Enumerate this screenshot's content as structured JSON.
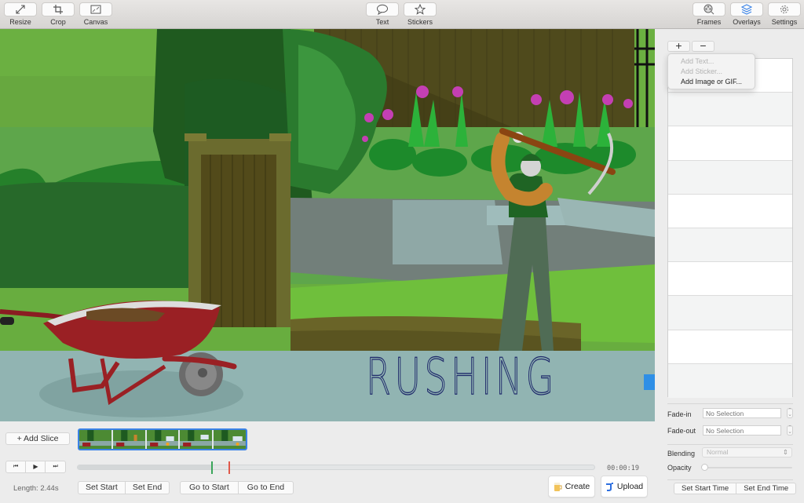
{
  "toolbar": {
    "left": [
      {
        "label": "Resize",
        "icon": "resize-icon"
      },
      {
        "label": "Crop",
        "icon": "crop-icon"
      },
      {
        "label": "Canvas",
        "icon": "canvas-icon"
      }
    ],
    "center": [
      {
        "label": "Text",
        "icon": "speech-bubble-icon"
      },
      {
        "label": "Stickers",
        "icon": "star-icon"
      }
    ],
    "right": [
      {
        "label": "Frames",
        "icon": "film-reel-icon"
      },
      {
        "label": "Overlays",
        "icon": "layers-icon",
        "active": true
      },
      {
        "label": "Settings",
        "icon": "gear-icon"
      }
    ]
  },
  "canvas": {
    "caption_text": "RUSHING",
    "caption_color": "#1f2a6b"
  },
  "sidebar": {
    "add_label": "+",
    "remove_label": "−",
    "add_menu": [
      {
        "label": "Add Text...",
        "enabled": false
      },
      {
        "label": "Add Sticker...",
        "enabled": false
      },
      {
        "label": "Add Image or GIF...",
        "enabled": true
      }
    ],
    "overlay_rows": 10,
    "fade_in": {
      "label": "Fade-in",
      "placeholder": "No Selection"
    },
    "fade_out": {
      "label": "Fade-out",
      "placeholder": "No Selection"
    },
    "blending": {
      "label": "Blending",
      "value": "Normal"
    },
    "opacity": {
      "label": "Opacity",
      "value": 0
    },
    "set_start_time": "Set Start Time",
    "set_end_time": "Set End Time"
  },
  "bottom": {
    "add_slice": "+ Add Slice",
    "filmstrip_frames": 5,
    "playback": {
      "prev": "⏮",
      "play": "▶",
      "next": "⏭"
    },
    "timeline": {
      "progress": 0.26,
      "start_marker": 0.258,
      "end_marker": 0.292
    },
    "timecode": "00:00:19",
    "length": "Length: 2.44s",
    "set_start": "Set Start",
    "set_end": "Set End",
    "go_to_start": "Go to Start",
    "go_to_end": "Go to End",
    "create": "Create",
    "upload": "Upload"
  },
  "colors": {
    "accent": "#3a82e6",
    "start_marker": "#3aa55a",
    "end_marker": "#e0584a"
  }
}
